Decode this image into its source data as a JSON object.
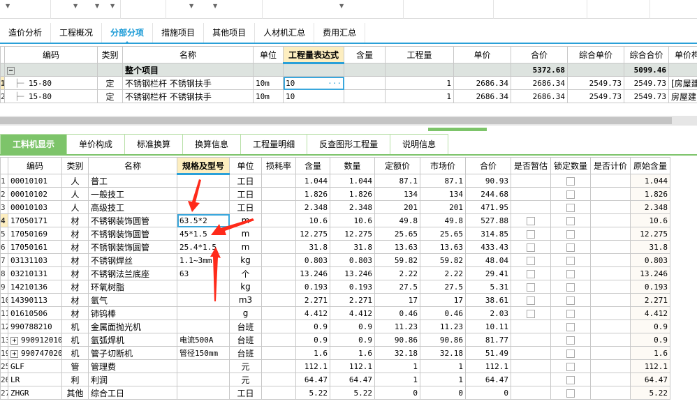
{
  "top_tabs": [
    "造价分析",
    "工程概况",
    "分部分项",
    "措施项目",
    "其他项目",
    "人材机汇总",
    "费用汇总"
  ],
  "top_active": 2,
  "top_grid": {
    "headers": [
      "编码",
      "类别",
      "名称",
      "单位",
      "工程量表达式",
      "含量",
      "工程量",
      "单价",
      "合价",
      "综合单价",
      "综合合价",
      "单价构"
    ],
    "group": {
      "toggle": "−",
      "name": "整个项目",
      "total": "5372.68",
      "comp_total": "5099.46"
    },
    "rows": [
      {
        "no": "1",
        "code": "15-80",
        "type": "定",
        "name": "不锈钢栏杆 不锈钢扶手",
        "unit": "10m",
        "expr": "10",
        "ellipsis": "···",
        "content": "",
        "qty": "1",
        "price": "2686.34",
        "total": "2686.34",
        "comp_price": "2549.73",
        "comp_total": "2549.73",
        "extra": "[房屋建"
      },
      {
        "no": "2",
        "code": "15-80",
        "type": "定",
        "name": "不锈钢栏杆 不锈钢扶手",
        "unit": "10m",
        "expr": "10",
        "ellipsis": "",
        "content": "",
        "qty": "1",
        "price": "2686.34",
        "total": "2686.34",
        "comp_price": "2549.73",
        "comp_total": "2549.73",
        "extra": "房屋建"
      }
    ]
  },
  "bottom_tabs": [
    "工料机显示",
    "单价构成",
    "标准换算",
    "换算信息",
    "工程量明细",
    "反查图形工程量",
    "说明信息"
  ],
  "bottom_grid": {
    "headers": [
      "编码",
      "类别",
      "名称",
      "规格及型号",
      "单位",
      "损耗率",
      "含量",
      "数量",
      "定额价",
      "市场价",
      "合价",
      "是否暂估",
      "锁定数量",
      "是否计价",
      "原始含量"
    ],
    "rows": [
      {
        "no": "1",
        "code": "00010101",
        "type": "人",
        "name": "普工",
        "spec": "",
        "unit": "工日",
        "content": "1.044",
        "qty": "1.044",
        "quota": "87.1",
        "market": "87.1",
        "total": "90.93",
        "est": false,
        "orig": "1.044"
      },
      {
        "no": "2",
        "code": "00010102",
        "type": "人",
        "name": "一般技工",
        "spec": "",
        "unit": "工日",
        "content": "1.826",
        "qty": "1.826",
        "quota": "134",
        "market": "134",
        "total": "244.68",
        "est": false,
        "orig": "1.826"
      },
      {
        "no": "3",
        "code": "00010103",
        "type": "人",
        "name": "高级技工",
        "spec": "",
        "unit": "工日",
        "content": "2.348",
        "qty": "2.348",
        "quota": "201",
        "market": "201",
        "total": "471.95",
        "est": false,
        "orig": "2.348"
      },
      {
        "no": "4",
        "code": "17050171",
        "type": "材",
        "name": "不锈钢装饰圆管",
        "spec": "63.5*2",
        "unit": "m",
        "content": "10.6",
        "qty": "10.6",
        "quota": "49.8",
        "market": "49.8",
        "total": "527.88",
        "est": true,
        "orig": "10.6"
      },
      {
        "no": "5",
        "code": "17050169",
        "type": "材",
        "name": "不锈钢装饰圆管",
        "spec": "45*1.5",
        "unit": "m",
        "content": "12.275",
        "qty": "12.275",
        "quota": "25.65",
        "market": "25.65",
        "total": "314.85",
        "est": true,
        "orig": "12.275"
      },
      {
        "no": "6",
        "code": "17050161",
        "type": "材",
        "name": "不锈钢装饰圆管",
        "spec": "25.4*1.5",
        "unit": "m",
        "content": "31.8",
        "qty": "31.8",
        "quota": "13.63",
        "market": "13.63",
        "total": "433.43",
        "est": true,
        "orig": "31.8"
      },
      {
        "no": "7",
        "code": "03131103",
        "type": "材",
        "name": "不锈钢焊丝",
        "spec": "1.1~3mm",
        "unit": "kg",
        "content": "0.803",
        "qty": "0.803",
        "quota": "59.82",
        "market": "59.82",
        "total": "48.04",
        "est": true,
        "orig": "0.803"
      },
      {
        "no": "8",
        "code": "03210131",
        "type": "材",
        "name": "不锈钢法兰底座",
        "spec": "63",
        "unit": "个",
        "content": "13.246",
        "qty": "13.246",
        "quota": "2.22",
        "market": "2.22",
        "total": "29.41",
        "est": true,
        "orig": "13.246"
      },
      {
        "no": "9",
        "code": "14210136",
        "type": "材",
        "name": "环氧树脂",
        "spec": "",
        "unit": "kg",
        "content": "0.193",
        "qty": "0.193",
        "quota": "27.5",
        "market": "27.5",
        "total": "5.31",
        "est": true,
        "orig": "0.193"
      },
      {
        "no": "10",
        "code": "14390113",
        "type": "材",
        "name": "氩气",
        "spec": "",
        "unit": "m3",
        "content": "2.271",
        "qty": "2.271",
        "quota": "17",
        "market": "17",
        "total": "38.61",
        "est": true,
        "orig": "2.271"
      },
      {
        "no": "11",
        "code": "01610506",
        "type": "材",
        "name": "铈钨棒",
        "spec": "",
        "unit": "g",
        "content": "4.412",
        "qty": "4.412",
        "quota": "0.46",
        "market": "0.46",
        "total": "2.03",
        "est": true,
        "orig": "4.412"
      },
      {
        "no": "12",
        "code": "990788210",
        "type": "机",
        "name": "金属面抛光机",
        "spec": "",
        "unit": "台班",
        "content": "0.9",
        "qty": "0.9",
        "quota": "11.23",
        "market": "11.23",
        "total": "10.11",
        "est": false,
        "orig": "0.9"
      },
      {
        "no": "13",
        "code": "990912010",
        "expand": "+",
        "type": "机",
        "name": "氩弧焊机",
        "spec": "电流500A",
        "unit": "台班",
        "content": "0.9",
        "qty": "0.9",
        "quota": "90.86",
        "market": "90.86",
        "total": "81.77",
        "est": false,
        "orig": "0.9"
      },
      {
        "no": "19",
        "code": "990747020",
        "expand": "+",
        "type": "机",
        "name": "管子切断机",
        "spec": "管径150mm",
        "unit": "台班",
        "content": "1.6",
        "qty": "1.6",
        "quota": "32.18",
        "market": "32.18",
        "total": "51.49",
        "est": false,
        "orig": "1.6"
      },
      {
        "no": "25",
        "code": "GLF",
        "type": "管",
        "name": "管理费",
        "spec": "",
        "unit": "元",
        "content": "112.1",
        "qty": "112.1",
        "quota": "1",
        "market": "1",
        "total": "112.1",
        "est": false,
        "orig": "112.1"
      },
      {
        "no": "26",
        "code": "LR",
        "type": "利",
        "name": "利润",
        "spec": "",
        "unit": "元",
        "content": "64.47",
        "qty": "64.47",
        "quota": "1",
        "market": "1",
        "total": "64.47",
        "est": false,
        "orig": "64.47"
      },
      {
        "no": "27",
        "code": "ZHGR",
        "type": "其他",
        "name": "综合工日",
        "spec": "",
        "unit": "工日",
        "content": "5.22",
        "qty": "5.22",
        "quota": "0",
        "market": "0",
        "total": "0",
        "est": false,
        "orig": "5.22"
      }
    ]
  },
  "colors": {
    "accent_blue": "#2aa0d8",
    "accent_green": "#7dc46a",
    "arrow_red": "#ff2a1a"
  }
}
